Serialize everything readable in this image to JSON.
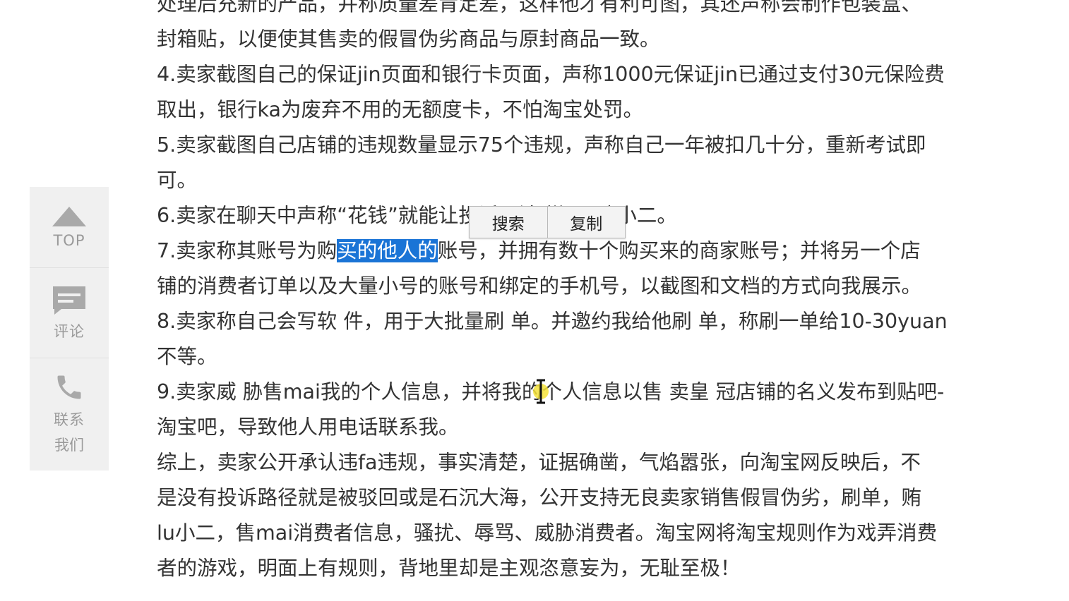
{
  "sidebar": {
    "top_label": "TOP",
    "comment_label": "评论",
    "contact_label_1": "联系",
    "contact_label_2": "我们"
  },
  "article": {
    "line0": "处理后充新的产品，并称质量差肯定差，这样他才有利可图，其还声称会制作包装盒、",
    "line1": "封箱贴，以便使其售卖的假冒伪劣商品与原封商品一致。",
    "p4_a": "4.卖家截图自己的保证jin页面和银行卡页面，声称1000元保证jin已通过支付30元保险费",
    "p4_b": "取出，银行ka为废弃不用的无额度卡，不怕淘宝处罚。",
    "p5_a": "5.卖家截图自己店铺的违规数量显示75个违规，声称自己一年被扣几十分，重新考试即",
    "p5_b": "可。",
    "p6_a": "6.卖家在聊天中声称“花钱”就能让投诉，涉 嫌hui赂小二。",
    "p7_a1": "7.卖家称其账号为购",
    "p7_sel": "买的他人的",
    "p7_a2": "账号，并拥有数十个购买来的商家账号；并将另一个店",
    "p7_b": "铺的消费者订单以及大量小号的账号和绑定的手机号，以截图和文档的方式向我展示。",
    "p8_a": "8.卖家称自己会写软 件，用于大批量刷 单。并邀约我给他刷 单，称刷一单给10-30yuan",
    "p8_b": "不等。",
    "p9_a": "9.卖家威 胁售mai我的个人信息，并将我的个人信息以售 卖皇 冠店铺的名义发布到贴吧-",
    "p9_b": "淘宝吧，导致他人用电话联系我。",
    "summary_a": "综上，卖家公开承认违fa违规，事实清楚，证据确凿，气焰嚣张，向淘宝网反映后，不",
    "summary_b": "是没有投诉路径就是被驳回或是石沉大海，公开支持无良卖家销售假冒伪劣，刷单，贿",
    "summary_c": "lu小二，售mai消费者信息，骚扰、辱骂、威胁消费者。淘宝网将淘宝规则作为戏弄消费",
    "summary_d": "者的游戏，明面上有规则，背地里却是主观恣意妄为，无耻至极！"
  },
  "context_menu": {
    "search_label": "搜索",
    "copy_label": "复制"
  },
  "colors": {
    "selection": "#1a74d6",
    "sidebar_bg": "#f0f0f0",
    "sidebar_icon": "#a9a9a9",
    "text": "#333333"
  }
}
